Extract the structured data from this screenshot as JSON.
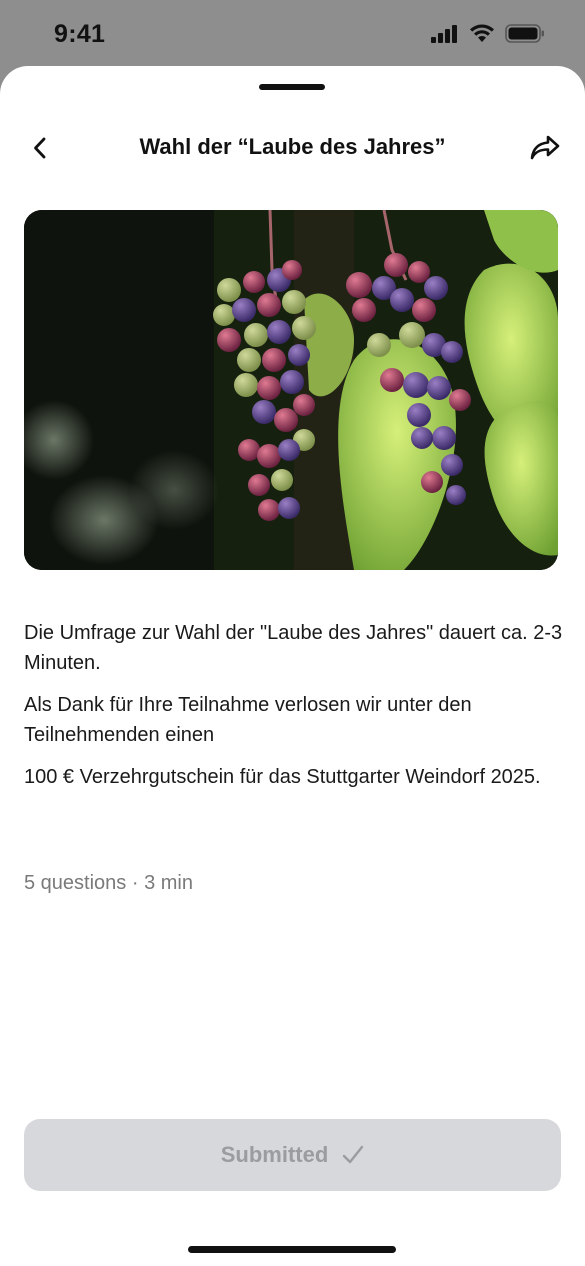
{
  "status_bar": {
    "time": "9:41"
  },
  "header": {
    "title": "Wahl der “Laube des Jahres”",
    "back_icon": "chevron-left-icon",
    "share_icon": "share-arrow-icon"
  },
  "hero_image": {
    "subject": "grape-clusters-photo"
  },
  "description": {
    "paragraphs": [
      "Die Umfrage zur Wahl der \"Laube des Jahres\" dauert ca. 2-3 Minuten.",
      "Als Dank für Ihre Teilnahme verlosen wir unter den Teilnehmenden einen",
      "100 € Verzehrgutschein für das Stuttgarter Weindorf 2025."
    ]
  },
  "meta": {
    "summary": "5 questions · 3 min"
  },
  "submit": {
    "label": "Submitted",
    "icon": "checkmark-icon",
    "state": "disabled"
  },
  "colors": {
    "sheet_bg": "#ffffff",
    "backdrop": "#8e8e8e",
    "button_bg": "#d7d8db",
    "button_text": "#9b9ca0",
    "meta_text": "#7a7a7a"
  }
}
